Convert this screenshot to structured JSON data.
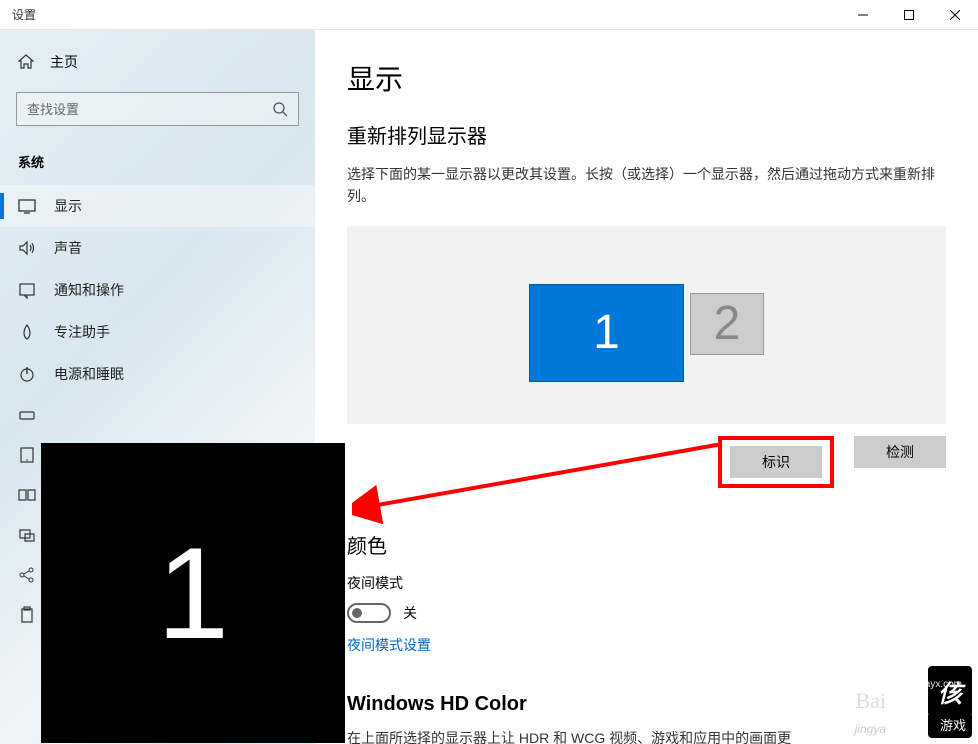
{
  "window": {
    "title": "设置"
  },
  "sidebar": {
    "home": "主页",
    "search_placeholder": "查找设置",
    "category": "系统",
    "items": [
      {
        "label": "显示"
      },
      {
        "label": "声音"
      },
      {
        "label": "通知和操作"
      },
      {
        "label": "专注助手"
      },
      {
        "label": "电源和睡眠"
      }
    ]
  },
  "main": {
    "title": "显示",
    "arrange": {
      "heading": "重新排列显示器",
      "desc": "选择下面的某一显示器以更改其设置。长按（或选择）一个显示器，然后通过拖动方式来重新排列。",
      "monitor1": "1",
      "monitor2": "2",
      "identify_btn": "标识",
      "detect_btn": "检测"
    },
    "color": {
      "heading": "颜色",
      "night_label": "夜间模式",
      "toggle_state": "关",
      "night_link": "夜间模式设置"
    },
    "hd": {
      "heading": "Windows HD Color",
      "desc": "在上面所选择的显示器上让 HDR 和 WCG 视频、游戏和应用中的画面更"
    }
  },
  "overlay": {
    "identify_number": "1"
  },
  "watermark": {
    "brand": "侅",
    "sub": "游戏",
    "url": "xiayx.com",
    "baidu": "Bai",
    "jingyan": "jingya"
  }
}
